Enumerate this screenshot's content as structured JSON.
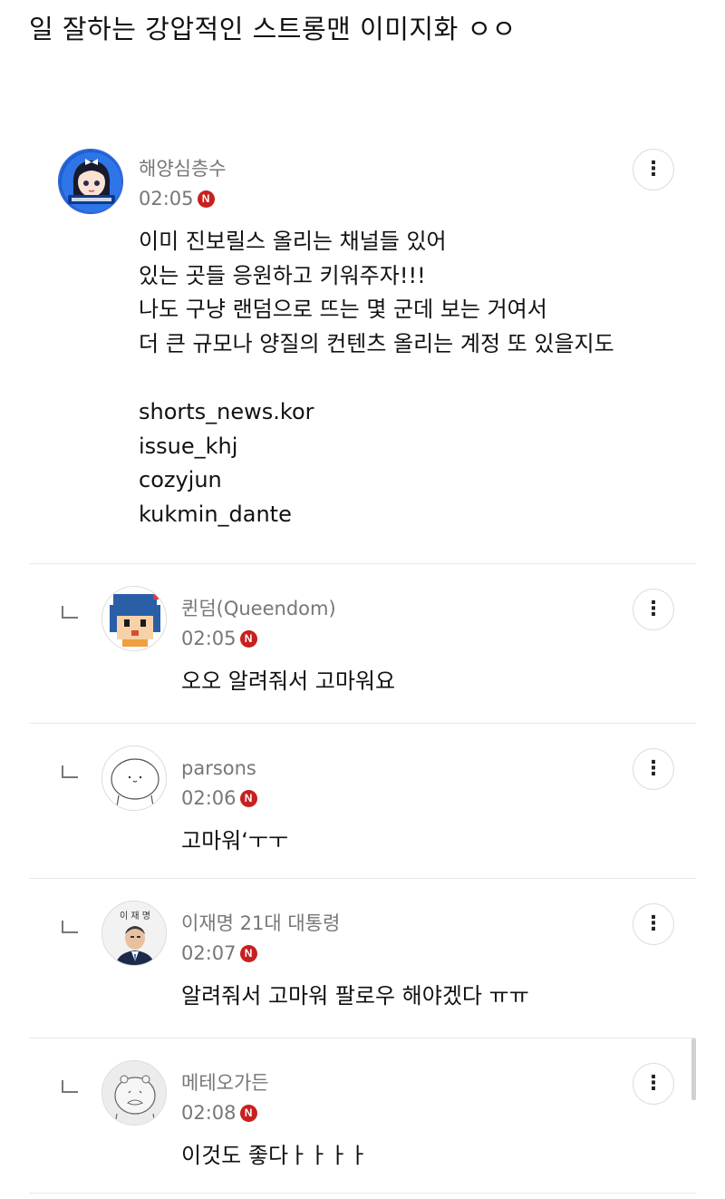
{
  "page": {
    "title": "일 잘하는 강압적인 스트롱맨 이미지화 ㅇㅇ"
  },
  "colors": {
    "badge": "#c82020",
    "meta_text": "#777777",
    "divider": "#e8e8e8"
  },
  "icons": {
    "more": "more-vertical-icon",
    "reply": "reply-arrow-icon",
    "badge": "n-badge-icon"
  },
  "main_comment": {
    "author": "해양심층수",
    "time": "02:05",
    "badge": "N",
    "lines": [
      "이미 진보릴스 올리는 채널들 있어",
      "있는 곳들 응원하고 키워주자!!!",
      "나도 구냥 랜덤으로 뜨는 몇 군데 보는 거여서",
      "더 큰 규모나 양질의 컨텐츠 올리는 계정 또 있을지도"
    ],
    "accounts": [
      "shorts_news.kor",
      "issue_khj",
      "cozyjun",
      "kukmin_dante"
    ]
  },
  "replies": [
    {
      "author": "퀸덤(Queendom)",
      "time": "02:05",
      "badge": "N",
      "text": "오오 알려줘서 고마워요"
    },
    {
      "author": "parsons",
      "time": "02:06",
      "badge": "N",
      "text": "고마워‘ㅜㅜ"
    },
    {
      "author": "이재명 21대 대통령",
      "time": "02:07",
      "badge": "N",
      "text": "알려줘서 고마워 팔로우 해야겠다 ㅠㅠ",
      "avatar_text": "이 재 명"
    },
    {
      "author": "메테오가든",
      "time": "02:08",
      "badge": "N",
      "text": "이것도 좋다ㅏㅏㅏㅏ"
    }
  ]
}
